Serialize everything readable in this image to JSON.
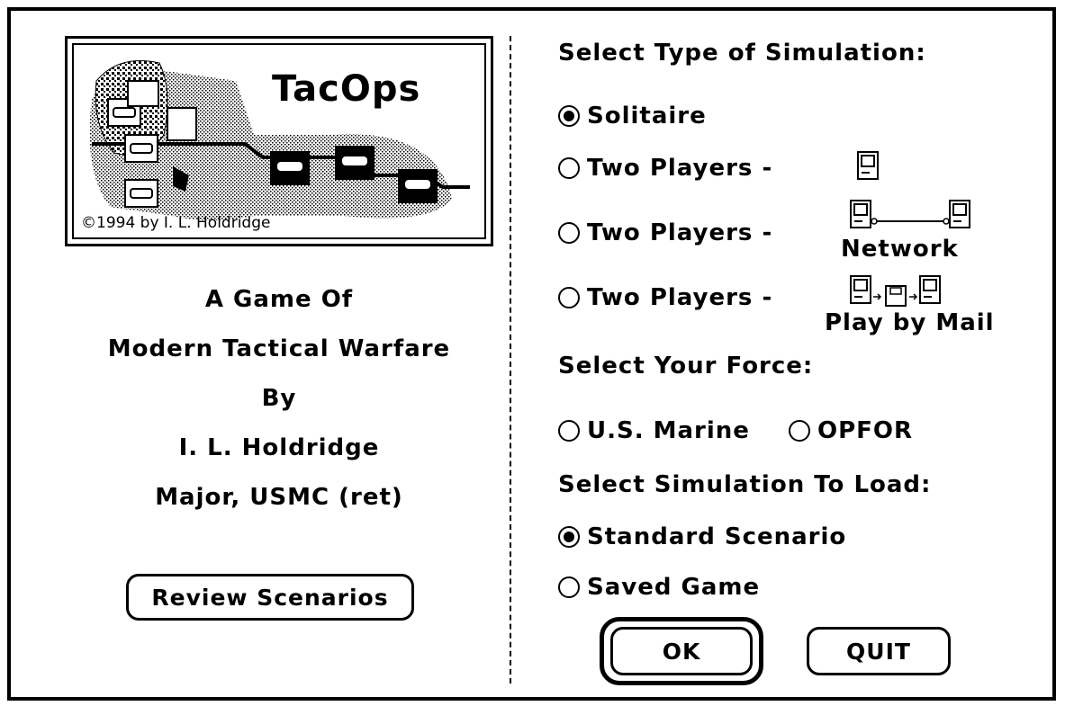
{
  "logo": {
    "title": "TacOps",
    "copyright": "©1994 by I. L. Holdridge"
  },
  "credits": {
    "line1": "A Game Of",
    "line2": "Modern Tactical Warfare",
    "line3": "By",
    "line4": "I. L. Holdridge",
    "line5": "Major, USMC (ret)"
  },
  "review_button": "Review Scenarios",
  "simulation_type": {
    "heading": "Select Type of Simulation:",
    "options": [
      {
        "label": "Solitaire",
        "selected": true
      },
      {
        "label": "Two Players -",
        "selected": false,
        "icon": "single-mac-icon"
      },
      {
        "label": "Two Players -",
        "selected": false,
        "icon": "network-icon",
        "icon_label": "Network"
      },
      {
        "label": "Two Players -",
        "selected": false,
        "icon": "play-by-mail-icon",
        "icon_label": "Play by Mail"
      }
    ]
  },
  "force": {
    "heading": "Select Your Force:",
    "options": [
      {
        "label": "U.S. Marine",
        "selected": false
      },
      {
        "label": "OPFOR",
        "selected": false
      }
    ]
  },
  "load": {
    "heading": "Select Simulation To Load:",
    "options": [
      {
        "label": "Standard Scenario",
        "selected": true
      },
      {
        "label": "Saved Game",
        "selected": false
      }
    ]
  },
  "buttons": {
    "ok": "OK",
    "quit": "QUIT"
  }
}
